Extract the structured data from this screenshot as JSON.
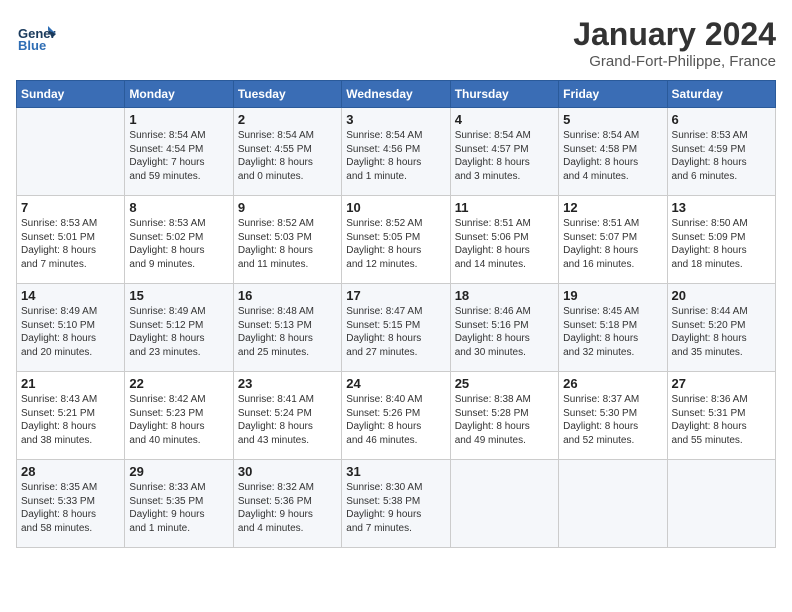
{
  "header": {
    "logo_general": "General",
    "logo_blue": "Blue",
    "month_title": "January 2024",
    "location": "Grand-Fort-Philippe, France"
  },
  "days_of_week": [
    "Sunday",
    "Monday",
    "Tuesday",
    "Wednesday",
    "Thursday",
    "Friday",
    "Saturday"
  ],
  "weeks": [
    [
      {
        "day": "",
        "info": ""
      },
      {
        "day": "1",
        "info": "Sunrise: 8:54 AM\nSunset: 4:54 PM\nDaylight: 7 hours\nand 59 minutes."
      },
      {
        "day": "2",
        "info": "Sunrise: 8:54 AM\nSunset: 4:55 PM\nDaylight: 8 hours\nand 0 minutes."
      },
      {
        "day": "3",
        "info": "Sunrise: 8:54 AM\nSunset: 4:56 PM\nDaylight: 8 hours\nand 1 minute."
      },
      {
        "day": "4",
        "info": "Sunrise: 8:54 AM\nSunset: 4:57 PM\nDaylight: 8 hours\nand 3 minutes."
      },
      {
        "day": "5",
        "info": "Sunrise: 8:54 AM\nSunset: 4:58 PM\nDaylight: 8 hours\nand 4 minutes."
      },
      {
        "day": "6",
        "info": "Sunrise: 8:53 AM\nSunset: 4:59 PM\nDaylight: 8 hours\nand 6 minutes."
      }
    ],
    [
      {
        "day": "7",
        "info": "Sunrise: 8:53 AM\nSunset: 5:01 PM\nDaylight: 8 hours\nand 7 minutes."
      },
      {
        "day": "8",
        "info": "Sunrise: 8:53 AM\nSunset: 5:02 PM\nDaylight: 8 hours\nand 9 minutes."
      },
      {
        "day": "9",
        "info": "Sunrise: 8:52 AM\nSunset: 5:03 PM\nDaylight: 8 hours\nand 11 minutes."
      },
      {
        "day": "10",
        "info": "Sunrise: 8:52 AM\nSunset: 5:05 PM\nDaylight: 8 hours\nand 12 minutes."
      },
      {
        "day": "11",
        "info": "Sunrise: 8:51 AM\nSunset: 5:06 PM\nDaylight: 8 hours\nand 14 minutes."
      },
      {
        "day": "12",
        "info": "Sunrise: 8:51 AM\nSunset: 5:07 PM\nDaylight: 8 hours\nand 16 minutes."
      },
      {
        "day": "13",
        "info": "Sunrise: 8:50 AM\nSunset: 5:09 PM\nDaylight: 8 hours\nand 18 minutes."
      }
    ],
    [
      {
        "day": "14",
        "info": "Sunrise: 8:49 AM\nSunset: 5:10 PM\nDaylight: 8 hours\nand 20 minutes."
      },
      {
        "day": "15",
        "info": "Sunrise: 8:49 AM\nSunset: 5:12 PM\nDaylight: 8 hours\nand 23 minutes."
      },
      {
        "day": "16",
        "info": "Sunrise: 8:48 AM\nSunset: 5:13 PM\nDaylight: 8 hours\nand 25 minutes."
      },
      {
        "day": "17",
        "info": "Sunrise: 8:47 AM\nSunset: 5:15 PM\nDaylight: 8 hours\nand 27 minutes."
      },
      {
        "day": "18",
        "info": "Sunrise: 8:46 AM\nSunset: 5:16 PM\nDaylight: 8 hours\nand 30 minutes."
      },
      {
        "day": "19",
        "info": "Sunrise: 8:45 AM\nSunset: 5:18 PM\nDaylight: 8 hours\nand 32 minutes."
      },
      {
        "day": "20",
        "info": "Sunrise: 8:44 AM\nSunset: 5:20 PM\nDaylight: 8 hours\nand 35 minutes."
      }
    ],
    [
      {
        "day": "21",
        "info": "Sunrise: 8:43 AM\nSunset: 5:21 PM\nDaylight: 8 hours\nand 38 minutes."
      },
      {
        "day": "22",
        "info": "Sunrise: 8:42 AM\nSunset: 5:23 PM\nDaylight: 8 hours\nand 40 minutes."
      },
      {
        "day": "23",
        "info": "Sunrise: 8:41 AM\nSunset: 5:24 PM\nDaylight: 8 hours\nand 43 minutes."
      },
      {
        "day": "24",
        "info": "Sunrise: 8:40 AM\nSunset: 5:26 PM\nDaylight: 8 hours\nand 46 minutes."
      },
      {
        "day": "25",
        "info": "Sunrise: 8:38 AM\nSunset: 5:28 PM\nDaylight: 8 hours\nand 49 minutes."
      },
      {
        "day": "26",
        "info": "Sunrise: 8:37 AM\nSunset: 5:30 PM\nDaylight: 8 hours\nand 52 minutes."
      },
      {
        "day": "27",
        "info": "Sunrise: 8:36 AM\nSunset: 5:31 PM\nDaylight: 8 hours\nand 55 minutes."
      }
    ],
    [
      {
        "day": "28",
        "info": "Sunrise: 8:35 AM\nSunset: 5:33 PM\nDaylight: 8 hours\nand 58 minutes."
      },
      {
        "day": "29",
        "info": "Sunrise: 8:33 AM\nSunset: 5:35 PM\nDaylight: 9 hours\nand 1 minute."
      },
      {
        "day": "30",
        "info": "Sunrise: 8:32 AM\nSunset: 5:36 PM\nDaylight: 9 hours\nand 4 minutes."
      },
      {
        "day": "31",
        "info": "Sunrise: 8:30 AM\nSunset: 5:38 PM\nDaylight: 9 hours\nand 7 minutes."
      },
      {
        "day": "",
        "info": ""
      },
      {
        "day": "",
        "info": ""
      },
      {
        "day": "",
        "info": ""
      }
    ]
  ]
}
